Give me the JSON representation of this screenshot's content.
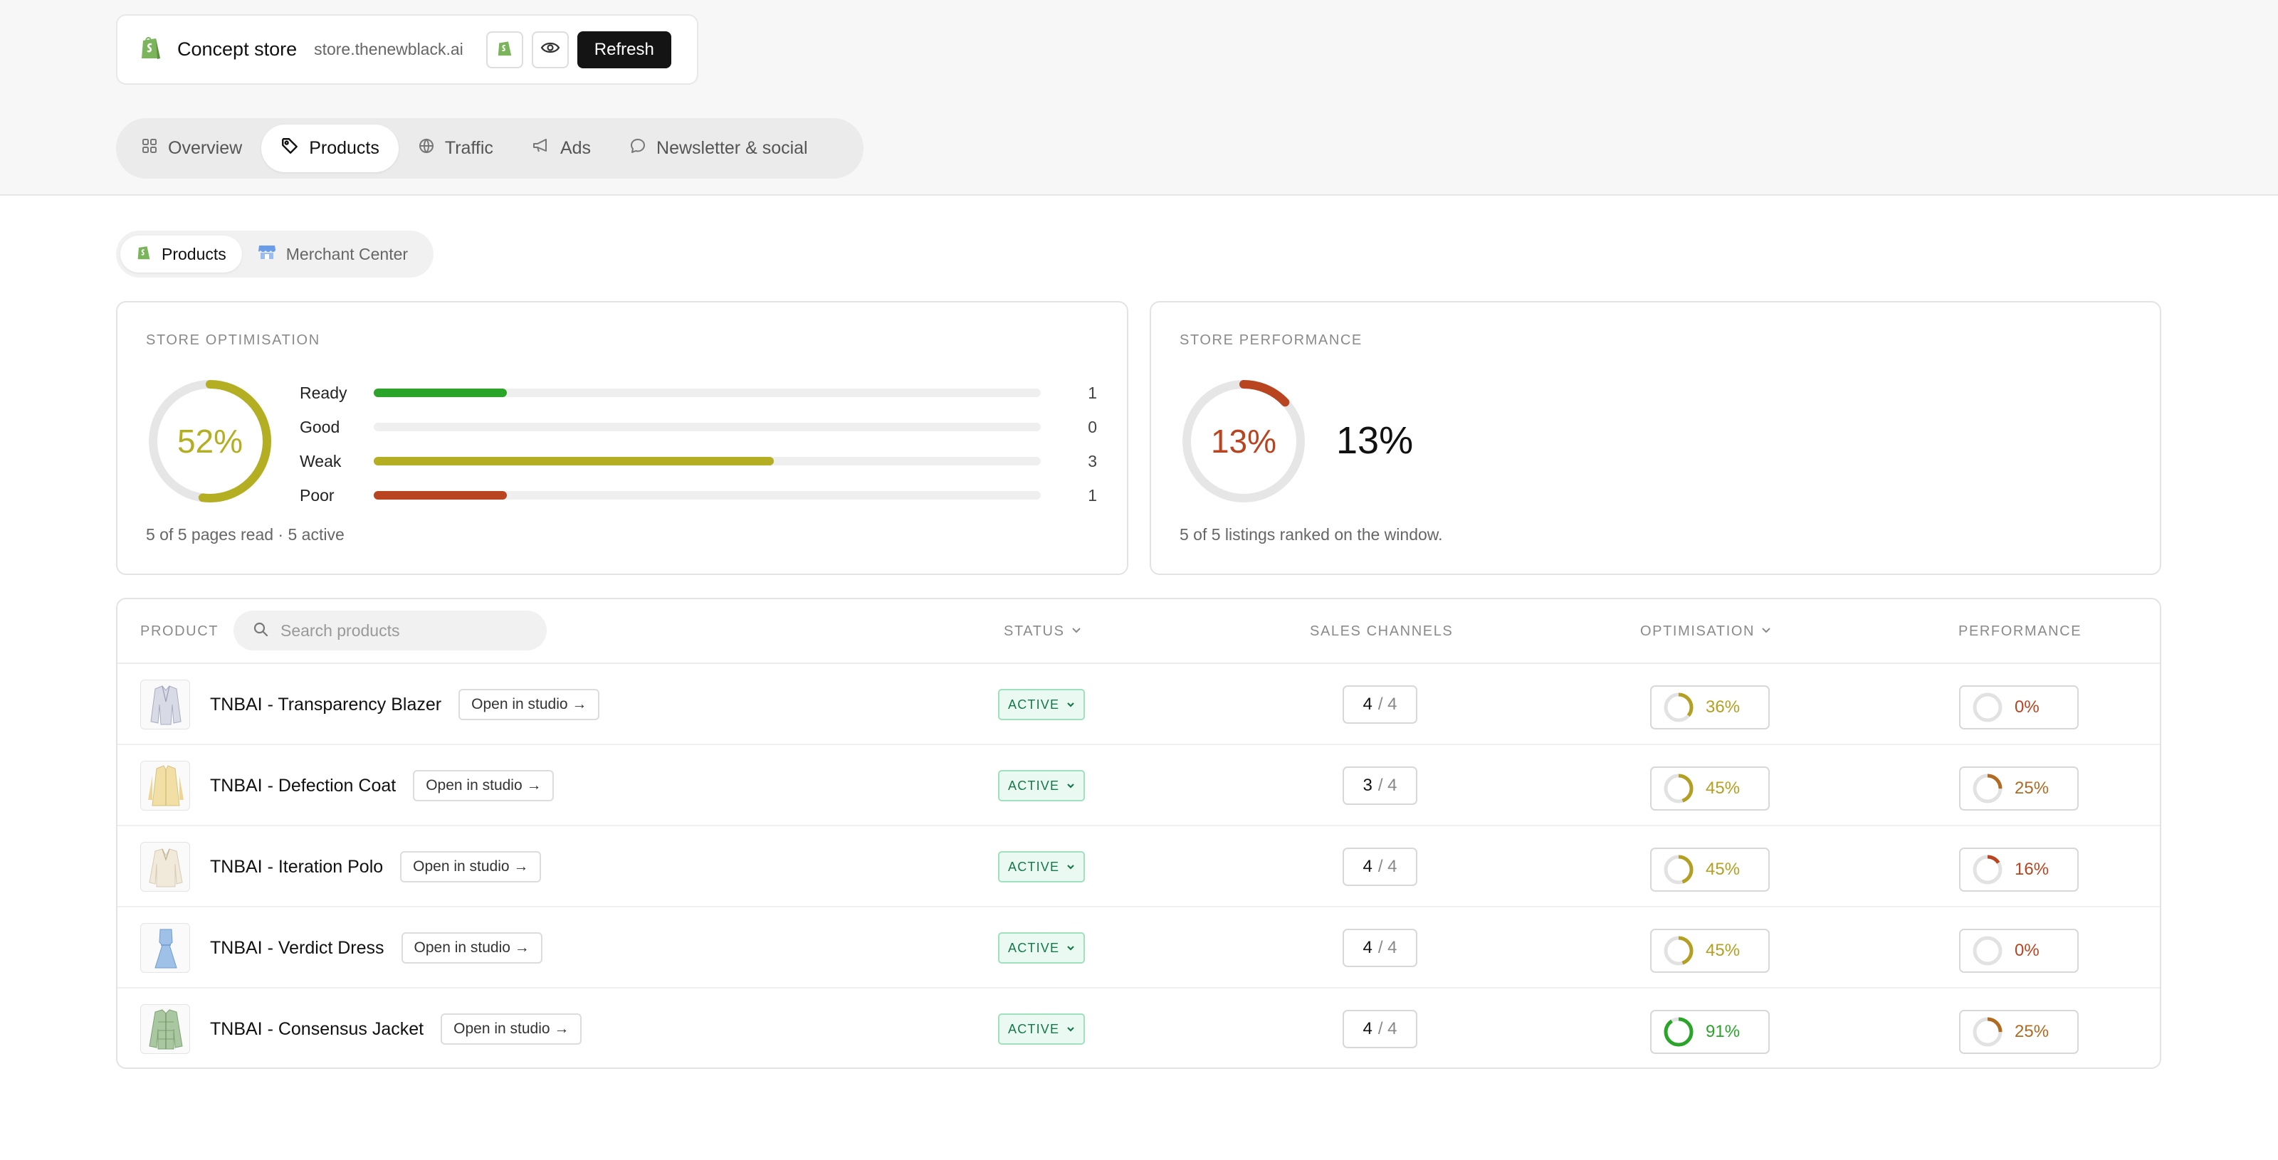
{
  "store": {
    "name": "Concept store",
    "domain": "store.thenewblack.ai",
    "refresh_label": "Refresh"
  },
  "nav": {
    "tabs": [
      {
        "label": "Overview",
        "icon": "grid-icon"
      },
      {
        "label": "Products",
        "icon": "tag-icon",
        "active": true
      },
      {
        "label": "Traffic",
        "icon": "globe-icon"
      },
      {
        "label": "Ads",
        "icon": "megaphone-icon"
      },
      {
        "label": "Newsletter & social",
        "icon": "chat-bubble-icon"
      }
    ]
  },
  "subtabs": [
    {
      "label": "Products",
      "icon": "shopify-icon",
      "active": true
    },
    {
      "label": "Merchant Center",
      "icon": "storefront-icon"
    }
  ],
  "optimisation": {
    "label": "STORE OPTIMISATION",
    "score_text": "52%",
    "score": 0.52,
    "color": "#b3ae22",
    "footer": "5 of 5 pages read · 5 active",
    "bars": [
      {
        "label": "Ready",
        "count": "1",
        "fraction": 0.2,
        "color": "#2aa52a"
      },
      {
        "label": "Good",
        "count": "0",
        "fraction": 0,
        "color": "#2aa52a"
      },
      {
        "label": "Weak",
        "count": "3",
        "fraction": 0.6,
        "color": "#b3ae22"
      },
      {
        "label": "Poor",
        "count": "1",
        "fraction": 0.2,
        "color": "#b8451f"
      }
    ]
  },
  "performance": {
    "label": "STORE PERFORMANCE",
    "score_text": "13%",
    "score": 0.13,
    "big_text": "13%",
    "color": "#b8451f",
    "footer": "5 of 5 listings ranked on the window."
  },
  "table": {
    "headers": {
      "product": "PRODUCT",
      "status": "STATUS",
      "channels": "SALES CHANNELS",
      "optimisation": "OPTIMISATION",
      "performance": "PERFORMANCE"
    },
    "search_placeholder": "Search products",
    "open_label": "Open in studio →",
    "rows": [
      {
        "name": "TNBAI - Transparency Blazer",
        "status": "ACTIVE",
        "channels": "4",
        "channels_total": "/ 4",
        "opt_text": "36%",
        "opt": 0.36,
        "opt_color": "#b3a022",
        "perf_text": "0%",
        "perf": 0,
        "perf_color": "#b8451f",
        "thumb": "blazer"
      },
      {
        "name": "TNBAI - Defection Coat",
        "status": "ACTIVE",
        "channels": "3",
        "channels_total": "/ 4",
        "opt_text": "45%",
        "opt": 0.45,
        "opt_color": "#b3a022",
        "perf_text": "25%",
        "perf": 0.25,
        "perf_color": "#b06a22",
        "thumb": "coat"
      },
      {
        "name": "TNBAI - Iteration Polo",
        "status": "ACTIVE",
        "channels": "4",
        "channels_total": "/ 4",
        "opt_text": "45%",
        "opt": 0.45,
        "opt_color": "#b3a022",
        "perf_text": "16%",
        "perf": 0.16,
        "perf_color": "#b8451f",
        "thumb": "polo"
      },
      {
        "name": "TNBAI - Verdict Dress",
        "status": "ACTIVE",
        "channels": "4",
        "channels_total": "/ 4",
        "opt_text": "45%",
        "opt": 0.45,
        "opt_color": "#b3a022",
        "perf_text": "0%",
        "perf": 0,
        "perf_color": "#b8451f",
        "thumb": "dress"
      },
      {
        "name": "TNBAI - Consensus Jacket",
        "status": "ACTIVE",
        "channels": "4",
        "channels_total": "/ 4",
        "opt_text": "91%",
        "opt": 0.91,
        "opt_color": "#2aa52a",
        "perf_text": "25%",
        "perf": 0.25,
        "perf_color": "#b06a22",
        "thumb": "jacket"
      }
    ]
  }
}
